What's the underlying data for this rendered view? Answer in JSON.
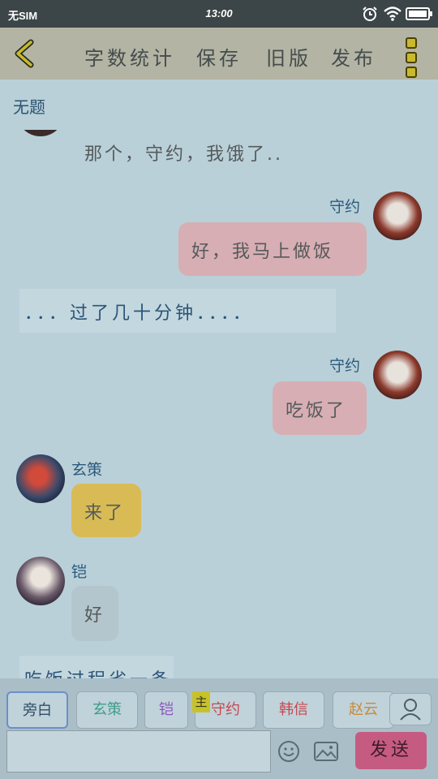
{
  "status_bar": {
    "carrier": "无SIM",
    "time": "13:00"
  },
  "toolbar": {
    "back_icon": "chevron-left-icon",
    "actions": [
      "字数统计",
      "保存",
      "旧版",
      "发布"
    ],
    "more_icon": "more-vertical-icon"
  },
  "document": {
    "title": "无题"
  },
  "messages": [
    {
      "type": "left",
      "speaker": "",
      "text": "那个，守约，我饿了..",
      "bubble_color": "#bacfd6"
    },
    {
      "type": "right",
      "speaker": "守约",
      "text": "好，我马上做饭",
      "bubble_color": "#d7aeb4"
    },
    {
      "type": "narration",
      "text": "．．．过了几十分钟．．．．"
    },
    {
      "type": "right",
      "speaker": "守约",
      "text": "吃饭了",
      "bubble_color": "#d7aeb4"
    },
    {
      "type": "left",
      "speaker": "玄策",
      "text": "来了",
      "bubble_color": "#d8bb55"
    },
    {
      "type": "left",
      "speaker": "铠",
      "text": "好",
      "bubble_color": "#b4c6cd"
    },
    {
      "type": "narration",
      "text": "吃饭过程省一条"
    }
  ],
  "roles": [
    {
      "label": "旁白",
      "color": "#2f4e66",
      "active": true
    },
    {
      "label": "玄策",
      "color": "#3f9c8c",
      "active": false
    },
    {
      "label": "铠",
      "color": "#8a58c0",
      "active": false
    },
    {
      "label": "守约",
      "color": "#c8484e",
      "active": false
    },
    {
      "label": "韩信",
      "color": "#c8484e",
      "active": false
    },
    {
      "label": "赵云",
      "color": "#c98a3a",
      "active": false
    }
  ],
  "main_tag": "主",
  "composer": {
    "input_value": "",
    "send_label": "发送"
  }
}
